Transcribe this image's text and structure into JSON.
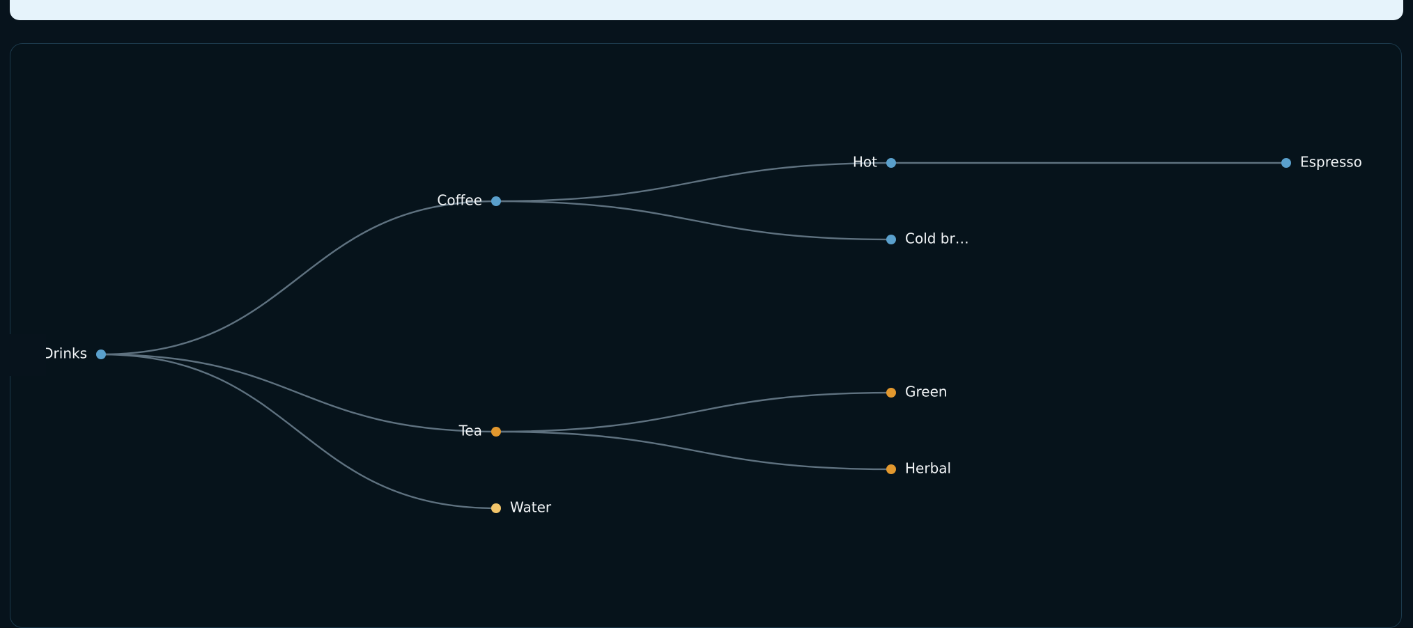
{
  "tree": {
    "link_color": "#5f7280",
    "nodes": [
      {
        "id": "drinks",
        "label": "Drinks",
        "color": "#5aa0cc",
        "label_side": "left"
      },
      {
        "id": "coffee",
        "label": "Coffee",
        "color": "#5aa0cc",
        "label_side": "left",
        "parent": "drinks"
      },
      {
        "id": "tea",
        "label": "Tea",
        "color": "#e2982e",
        "label_side": "left",
        "parent": "drinks"
      },
      {
        "id": "water",
        "label": "Water",
        "color": "#f2c56a",
        "label_side": "right",
        "parent": "drinks"
      },
      {
        "id": "hot",
        "label": "Hot",
        "color": "#5aa0cc",
        "label_side": "left",
        "parent": "coffee"
      },
      {
        "id": "coldbrew",
        "label": "Cold br…",
        "color": "#5aa0cc",
        "label_side": "right",
        "parent": "coffee"
      },
      {
        "id": "green",
        "label": "Green",
        "color": "#e2982e",
        "label_side": "right",
        "parent": "tea"
      },
      {
        "id": "herbal",
        "label": "Herbal",
        "color": "#e2982e",
        "label_side": "right",
        "parent": "tea"
      },
      {
        "id": "espresso",
        "label": "Espresso",
        "color": "#5aa0cc",
        "label_side": "right",
        "parent": "hot"
      }
    ]
  }
}
